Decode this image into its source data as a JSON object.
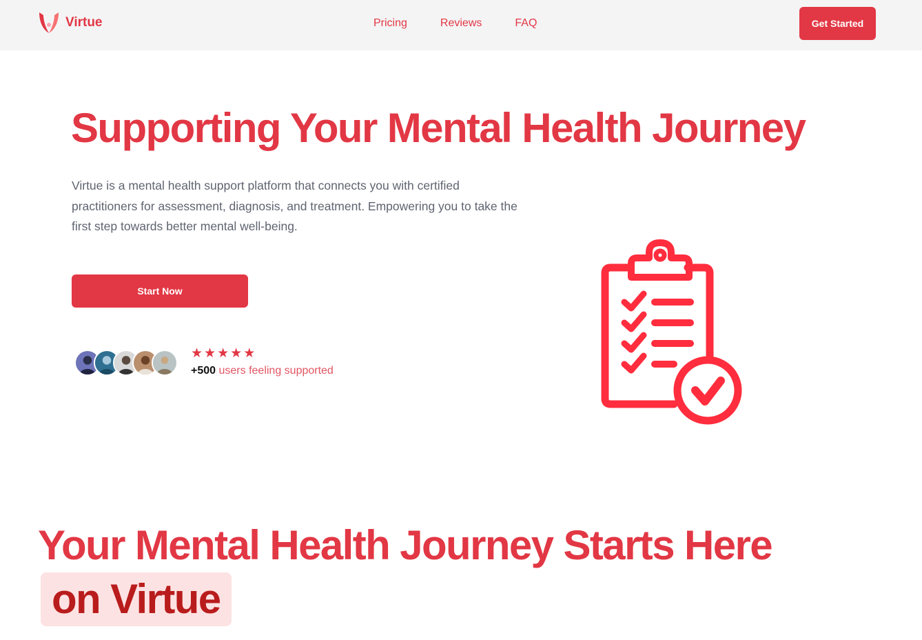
{
  "brand": {
    "name": "Virtue",
    "color": "#e23744"
  },
  "nav": {
    "links": [
      "Pricing",
      "Reviews",
      "FAQ"
    ],
    "cta_label": "Get Started"
  },
  "hero": {
    "title": "Supporting Your Mental Health Journey",
    "description": "Virtue is a mental health support platform that connects you with certified practitioners for assessment, diagnosis, and treatment. Empowering you to take the first step towards better mental well-being.",
    "cta_label": "Start Now",
    "rating_stars": 5,
    "star_glyph": "★",
    "users_count": "+500",
    "users_text": "users feeling supported",
    "illustration_icon": "clipboard-checklist-icon"
  },
  "section": {
    "title_main": "Your Mental Health Journey Starts Here",
    "title_highlight": "on Virtue"
  }
}
